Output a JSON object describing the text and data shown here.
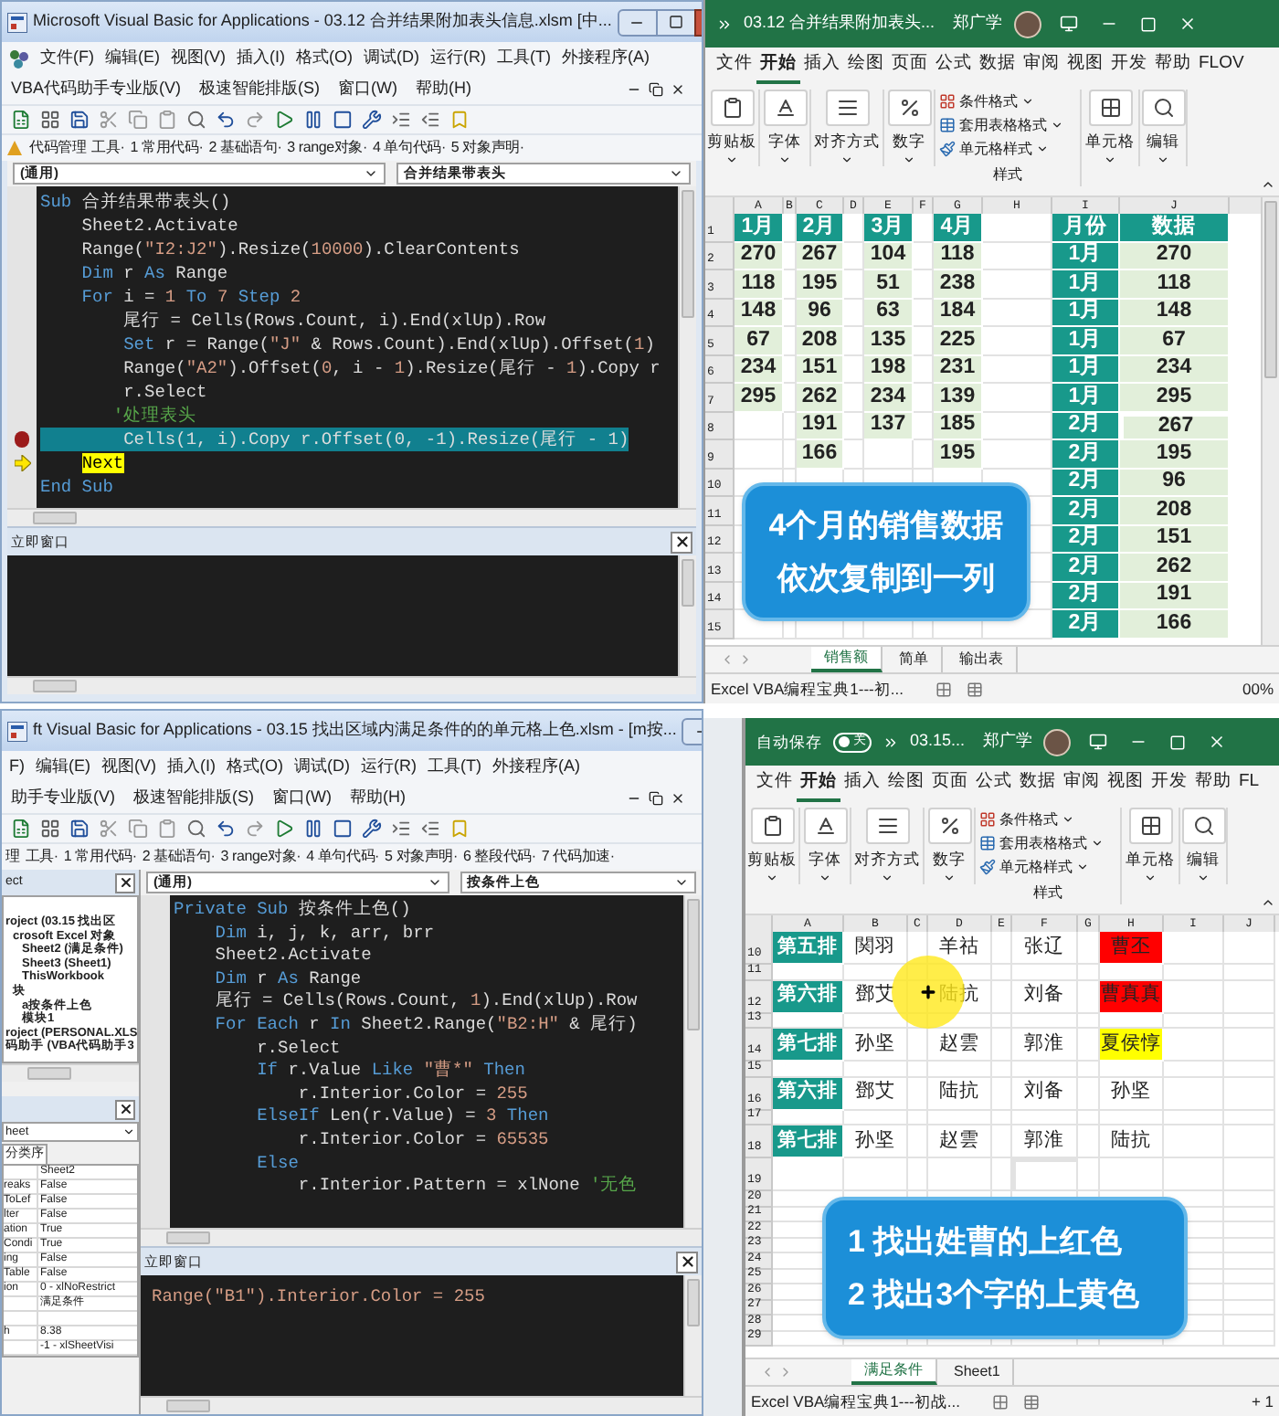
{
  "vba_windows": [
    {
      "title": "Microsoft Visual Basic for Applications - 03.12 合并结果附加表头信息.xlsm [中...",
      "menus": [
        [
          "文件(F)",
          "编辑(E)",
          "视图(V)",
          "插入(I)",
          "格式(O)",
          "调试(D)",
          "运行(R)",
          "工具(T)",
          "外接程序(A)"
        ],
        [
          "VBA代码助手专业版(V)",
          "极速智能排版(S)",
          "窗口(W)",
          "帮助(H)"
        ]
      ],
      "addin_icon": true,
      "addins": [
        "代码管理",
        "工具·",
        "1 常用代码·",
        "2 基础语句·",
        "3 range对象·",
        "4 单句代码·",
        "5 对象声明·"
      ],
      "object_box": "(通用)",
      "proc_box": "合并结果带表头",
      "code": [
        {
          "kind": "plain",
          "tokens": [
            {
              "kind": "kw",
              "text": "Sub "
            },
            {
              "kind": "tx",
              "text": "合并结果带表头()"
            }
          ]
        },
        {
          "kind": "plain",
          "tokens": [
            {
              "kind": "tx",
              "text": "    Sheet2.Activate"
            }
          ]
        },
        {
          "kind": "plain",
          "tokens": [
            {
              "kind": "tx",
              "text": "    Range("
            },
            {
              "kind": "str",
              "text": "\"I2:J2\""
            },
            {
              "kind": "tx",
              "text": ").Resize("
            },
            {
              "kind": "num",
              "text": "10000"
            },
            {
              "kind": "tx",
              "text": ").ClearContents"
            }
          ]
        },
        {
          "kind": "plain",
          "tokens": [
            {
              "kind": "kw",
              "text": "    Dim "
            },
            {
              "kind": "tx",
              "text": "r "
            },
            {
              "kind": "kw",
              "text": "As "
            },
            {
              "kind": "tx",
              "text": "Range"
            }
          ]
        },
        {
          "kind": "plain",
          "tokens": [
            {
              "kind": "kw",
              "text": "    For "
            },
            {
              "kind": "tx",
              "text": "i = "
            },
            {
              "kind": "num",
              "text": "1"
            },
            {
              "kind": "kw",
              "text": " To "
            },
            {
              "kind": "num",
              "text": "7"
            },
            {
              "kind": "kw",
              "text": " Step "
            },
            {
              "kind": "num",
              "text": "2"
            }
          ]
        },
        {
          "kind": "plain",
          "tokens": [
            {
              "kind": "tx",
              "text": "        尾行 = Cells(Rows.Count, i).End(xlUp).Row"
            }
          ]
        },
        {
          "kind": "plain",
          "tokens": [
            {
              "kind": "kw",
              "text": "        Set "
            },
            {
              "kind": "tx",
              "text": "r = Range("
            },
            {
              "kind": "str",
              "text": "\"J\""
            },
            {
              "kind": "tx",
              "text": " & Rows.Count).End(xlUp).Offset("
            },
            {
              "kind": "num",
              "text": "1"
            },
            {
              "kind": "tx",
              "text": ")"
            }
          ]
        },
        {
          "kind": "plain",
          "tokens": [
            {
              "kind": "tx",
              "text": "        Range("
            },
            {
              "kind": "str",
              "text": "\"A2\""
            },
            {
              "kind": "tx",
              "text": ").Offset("
            },
            {
              "kind": "num",
              "text": "0"
            },
            {
              "kind": "tx",
              "text": ", i - "
            },
            {
              "kind": "num",
              "text": "1"
            },
            {
              "kind": "tx",
              "text": ").Resize(尾行 - "
            },
            {
              "kind": "num",
              "text": "1"
            },
            {
              "kind": "tx",
              "text": ").Copy r"
            }
          ]
        },
        {
          "kind": "plain",
          "tokens": [
            {
              "kind": "tx",
              "text": "        r.Select"
            }
          ]
        },
        {
          "kind": "plain",
          "tokens": [
            {
              "kind": "cmt",
              "text": "       '处理表头"
            }
          ]
        },
        {
          "kind": "breakpoint",
          "tokens": [
            {
              "kind": "tx",
              "text": "        Cells(1, i).Copy r.Offset(0, -1).Resize(尾行 - 1)"
            }
          ]
        },
        {
          "kind": "current",
          "tokens": [
            {
              "kind": "exec",
              "text": "    Next"
            }
          ]
        },
        {
          "kind": "plain",
          "tokens": [
            {
              "kind": "kw",
              "text": "End Sub"
            }
          ]
        }
      ],
      "immediate": {
        "title": "立即窗口"
      }
    },
    {
      "title": "ft Visual Basic for Applications - 03.15 找出区域内满足条件的的单元格上色.xlsm - [m按...",
      "menus": [
        [
          "F)",
          "编辑(E)",
          "视图(V)",
          "插入(I)",
          "格式(O)",
          "调试(D)",
          "运行(R)",
          "工具(T)",
          "外接程序(A)"
        ],
        [
          "助手专业版(V)",
          "极速智能排版(S)",
          "窗口(W)",
          "帮助(H)"
        ]
      ],
      "addin_icon": false,
      "addins": [
        "理",
        "工具·",
        "1 常用代码·",
        "2 基础语句·",
        "3 range对象·",
        "4 单句代码·",
        "5 对象声明·",
        "6 整段代码·",
        "7 代码加速·"
      ],
      "object_box": "(通用)",
      "proc_box": "按条件上色",
      "project": {
        "title": "ect",
        "items": [
          {
            "label": "roject (03.15 找出区",
            "children": [
              {
                "label": "crosoft Excel 对象",
                "children": [
                  {
                    "label": "Sheet2 (满足条件)"
                  },
                  {
                    "label": "Sheet3 (Sheet1)"
                  },
                  {
                    "label": "ThisWorkbook"
                  }
                ]
              },
              {
                "label": "块",
                "children": [
                  {
                    "label": "a按条件上色"
                  },
                  {
                    "label": "模块1"
                  }
                ]
              }
            ]
          },
          {
            "label": "roject (PERSONAL.XLS"
          },
          {
            "label": "码助手 (VBA代码助手3"
          }
        ]
      },
      "properties": {
        "object": "heet",
        "tab": "分类序",
        "rows": [
          {
            "value": "Sheet2"
          },
          {
            "name": "reaks",
            "value": "False"
          },
          {
            "name": "ToLef",
            "value": "False"
          },
          {
            "name": "lter",
            "value": "False"
          },
          {
            "name": "ation",
            "value": "True"
          },
          {
            "name": "Condi",
            "value": "True"
          },
          {
            "name": "ing",
            "value": "False"
          },
          {
            "name": "Table",
            "value": "False"
          },
          {
            "name": "ion",
            "value": "0 - xlNoRestrict"
          },
          {
            "value": "满足条件"
          },
          {},
          {
            "name": "h",
            "value": "8.38"
          },
          {
            "value": "-1 - xlSheetVisi"
          }
        ]
      },
      "code": [
        {
          "kind": "plain",
          "tokens": [
            {
              "kind": "kw",
              "text": "Private Sub "
            },
            {
              "kind": "tx",
              "text": "按条件上色()"
            }
          ]
        },
        {
          "kind": "plain",
          "tokens": [
            {
              "kind": "kw",
              "text": "    Dim "
            },
            {
              "kind": "tx",
              "text": "i, j, k, arr, brr"
            }
          ]
        },
        {
          "kind": "plain",
          "tokens": [
            {
              "kind": "tx",
              "text": "    Sheet2.Activate"
            }
          ]
        },
        {
          "kind": "plain",
          "tokens": [
            {
              "kind": "kw",
              "text": "    Dim "
            },
            {
              "kind": "tx",
              "text": "r "
            },
            {
              "kind": "kw",
              "text": "As "
            },
            {
              "kind": "tx",
              "text": "Range"
            }
          ]
        },
        {
          "kind": "plain",
          "tokens": [
            {
              "kind": "tx",
              "text": "    尾行 = Cells(Rows.Count, "
            },
            {
              "kind": "num",
              "text": "1"
            },
            {
              "kind": "tx",
              "text": ").End(xlUp).Row"
            }
          ]
        },
        {
          "kind": "plain",
          "tokens": [
            {
              "kind": "kw",
              "text": "    For Each "
            },
            {
              "kind": "tx",
              "text": "r "
            },
            {
              "kind": "kw",
              "text": "In "
            },
            {
              "kind": "tx",
              "text": "Sheet2.Range("
            },
            {
              "kind": "str",
              "text": "\"B2:H\""
            },
            {
              "kind": "tx",
              "text": " & 尾行)"
            }
          ]
        },
        {
          "kind": "plain",
          "tokens": [
            {
              "kind": "tx",
              "text": "        r.Select"
            }
          ]
        },
        {
          "kind": "plain",
          "tokens": [
            {
              "kind": "kw",
              "text": "        If "
            },
            {
              "kind": "tx",
              "text": "r.Value "
            },
            {
              "kind": "kw",
              "text": "Like "
            },
            {
              "kind": "str",
              "text": "\"曹*\""
            },
            {
              "kind": "kw",
              "text": " Then"
            }
          ]
        },
        {
          "kind": "plain",
          "tokens": [
            {
              "kind": "tx",
              "text": "            r.Interior.Color = "
            },
            {
              "kind": "num",
              "text": "255"
            }
          ]
        },
        {
          "kind": "plain",
          "tokens": [
            {
              "kind": "kw",
              "text": "        ElseIf "
            },
            {
              "kind": "tx",
              "text": "Len(r.Value) = "
            },
            {
              "kind": "num",
              "text": "3"
            },
            {
              "kind": "kw",
              "text": " Then"
            }
          ]
        },
        {
          "kind": "plain",
          "tokens": [
            {
              "kind": "tx",
              "text": "            r.Interior.Color = "
            },
            {
              "kind": "num",
              "text": "65535"
            }
          ]
        },
        {
          "kind": "plain",
          "tokens": [
            {
              "kind": "kw",
              "text": "        Else"
            }
          ]
        },
        {
          "kind": "plain",
          "tokens": [
            {
              "kind": "tx",
              "text": "            r.Interior.Pattern = xlNone "
            },
            {
              "kind": "cmt",
              "text": "'无色"
            }
          ]
        }
      ],
      "immediate": {
        "title": "立即窗口",
        "lines": [
          {
            "tokens": [
              {
                "kind": "str",
                "text": "Range(\"B1\").Interior.Color = 255"
              }
            ]
          }
        ]
      }
    }
  ],
  "excel_windows": [
    {
      "title": "03.12 合并结果附加表头...",
      "user": "郑广学",
      "tabs": [
        {
          "label": "文件",
          "selected": false
        },
        {
          "label": "开始",
          "selected": true
        },
        {
          "label": "插入",
          "selected": false
        },
        {
          "label": "绘图",
          "selected": false
        },
        {
          "label": "页面",
          "selected": false
        },
        {
          "label": "公式",
          "selected": false
        },
        {
          "label": "数据",
          "selected": false
        },
        {
          "label": "审阅",
          "selected": false
        },
        {
          "label": "视图",
          "selected": false
        },
        {
          "label": "开发",
          "selected": false
        },
        {
          "label": "帮助",
          "selected": false
        },
        {
          "label": "FLOV",
          "selected": false
        }
      ],
      "groups": [
        {
          "kind": "clipboard",
          "label": "剪贴板"
        },
        {
          "kind": "font",
          "label": "字体"
        },
        {
          "kind": "align",
          "label": "对齐方式"
        },
        {
          "kind": "number",
          "label": "数字"
        },
        {
          "kind": "styles",
          "label": "样式",
          "items": [
            "条件格式",
            "套用表格格式",
            "单元格样式"
          ]
        },
        {
          "kind": "cells",
          "label": "单元格"
        },
        {
          "kind": "edit",
          "label": "编辑"
        }
      ],
      "sheet": {
        "columns": [
          {
            "name": "A",
            "kind": "band"
          },
          {
            "name": "B",
            "kind": "plain"
          },
          {
            "name": "C",
            "kind": "band"
          },
          {
            "name": "D",
            "kind": "plain"
          },
          {
            "name": "E",
            "kind": "band"
          },
          {
            "name": "F",
            "kind": "plain"
          },
          {
            "name": "G",
            "kind": "band"
          },
          {
            "name": "H",
            "kind": "plain"
          },
          {
            "name": "I",
            "kind": "label"
          },
          {
            "name": "J",
            "kind": "band"
          }
        ],
        "rows": [
          {
            "n": "1",
            "header": true,
            "cells": [
              "1月",
              null,
              "2月",
              null,
              "3月",
              null,
              "4月",
              null,
              "月份",
              "数据"
            ]
          },
          {
            "n": "2",
            "header": false,
            "cells": [
              "270",
              null,
              "267",
              null,
              "104",
              null,
              "118",
              null,
              "1月",
              "270"
            ]
          },
          {
            "n": "3",
            "header": false,
            "cells": [
              "118",
              null,
              "195",
              null,
              "51",
              null,
              "238",
              null,
              "1月",
              "118"
            ]
          },
          {
            "n": "4",
            "header": false,
            "cells": [
              "148",
              null,
              "96",
              null,
              "63",
              null,
              "184",
              null,
              "1月",
              "148"
            ]
          },
          {
            "n": "5",
            "header": false,
            "cells": [
              "67",
              null,
              "208",
              null,
              "135",
              null,
              "225",
              null,
              "1月",
              "67"
            ]
          },
          {
            "n": "6",
            "header": false,
            "cells": [
              "234",
              null,
              "151",
              null,
              "198",
              null,
              "231",
              null,
              "1月",
              "234"
            ]
          },
          {
            "n": "7",
            "header": false,
            "cells": [
              "295",
              null,
              "262",
              null,
              "234",
              null,
              "139",
              null,
              "1月",
              "295"
            ]
          },
          {
            "n": "8",
            "header": false,
            "cells": [
              null,
              null,
              "191",
              null,
              "137",
              null,
              "185",
              null,
              "2月",
              {
                "v": "267",
                "selected": true
              }
            ]
          },
          {
            "n": "9",
            "header": false,
            "cells": [
              null,
              null,
              "166",
              null,
              null,
              null,
              "195",
              null,
              "2月",
              "195"
            ]
          },
          {
            "n": "10",
            "header": false,
            "cells": [
              null,
              null,
              null,
              null,
              null,
              null,
              null,
              null,
              "2月",
              "96"
            ]
          },
          {
            "n": "11",
            "header": false,
            "cells": [
              null,
              null,
              null,
              null,
              null,
              null,
              null,
              null,
              "2月",
              "208"
            ]
          },
          {
            "n": "12",
            "header": false,
            "cells": [
              null,
              null,
              null,
              null,
              null,
              null,
              null,
              null,
              "2月",
              "151"
            ]
          },
          {
            "n": "13",
            "header": false,
            "cells": [
              null,
              null,
              null,
              null,
              null,
              null,
              null,
              null,
              "2月",
              "262"
            ]
          },
          {
            "n": "14",
            "header": false,
            "cells": [
              null,
              null,
              null,
              null,
              null,
              null,
              null,
              null,
              "2月",
              "191"
            ]
          },
          {
            "n": "15",
            "header": false,
            "cells": [
              null,
              null,
              null,
              null,
              null,
              null,
              null,
              null,
              "2月",
              "166"
            ]
          }
        ]
      },
      "sheet_tabs": [
        {
          "label": "销售额",
          "selected": true
        },
        {
          "label": "简单",
          "selected": false
        },
        {
          "label": "输出表",
          "selected": false
        }
      ],
      "status": "Excel VBA编程宝典1---初...",
      "zoom": "00%",
      "callout": [
        "4个月的销售数据",
        "依次复制到一列"
      ],
      "cursor_highlight": false
    },
    {
      "autosave": {
        "label": "自动保存",
        "on": false,
        "text": "关"
      },
      "title": "03.15...",
      "user": "郑广学",
      "tabs": [
        {
          "label": "文件",
          "selected": false
        },
        {
          "label": "开始",
          "selected": true
        },
        {
          "label": "插入",
          "selected": false
        },
        {
          "label": "绘图",
          "selected": false
        },
        {
          "label": "页面",
          "selected": false
        },
        {
          "label": "公式",
          "selected": false
        },
        {
          "label": "数据",
          "selected": false
        },
        {
          "label": "审阅",
          "selected": false
        },
        {
          "label": "视图",
          "selected": false
        },
        {
          "label": "开发",
          "selected": false
        },
        {
          "label": "帮助",
          "selected": false
        },
        {
          "label": "FL",
          "selected": false
        }
      ],
      "groups": [
        {
          "kind": "clipboard",
          "label": "剪贴板"
        },
        {
          "kind": "font",
          "label": "字体"
        },
        {
          "kind": "align",
          "label": "对齐方式"
        },
        {
          "kind": "number",
          "label": "数字"
        },
        {
          "kind": "styles",
          "label": "样式",
          "items": [
            "条件格式",
            "套用表格格式",
            "单元格样式"
          ]
        },
        {
          "kind": "cells",
          "label": "单元格"
        },
        {
          "kind": "edit",
          "label": "编辑"
        }
      ],
      "sheet": {
        "columns": [
          {
            "name": "A",
            "kind": "label"
          },
          {
            "name": "B",
            "kind": "plain"
          },
          {
            "name": "C",
            "kind": "plain"
          },
          {
            "name": "D",
            "kind": "plain"
          },
          {
            "name": "E",
            "kind": "plain"
          },
          {
            "name": "F",
            "kind": "plain"
          },
          {
            "name": "G",
            "kind": "plain"
          },
          {
            "name": "H",
            "kind": "plain"
          },
          {
            "name": "I",
            "kind": "plain"
          },
          {
            "name": "J",
            "kind": "plain"
          }
        ],
        "rows": [
          {
            "n": "10",
            "cells": [
              "第五排",
              "関羽",
              null,
              "羊祜",
              null,
              "张辽",
              null,
              {
                "v": "曹丕",
                "color": "#ff0000"
              }
            ]
          },
          {
            "n": "11"
          },
          {
            "n": "12",
            "cells": [
              "第六排",
              "鄧艾",
              null,
              "陆抗",
              null,
              "刘备",
              null,
              {
                "v": "曹真真",
                "color": "#ff0000"
              }
            ]
          },
          {
            "n": "13"
          },
          {
            "n": "14",
            "cells": [
              "第七排",
              "孙坚",
              null,
              "赵雲",
              null,
              "郭淮",
              null,
              {
                "v": "夏侯惇",
                "color": "#ffff00"
              }
            ]
          },
          {
            "n": "15"
          },
          {
            "n": "16",
            "cells": [
              "第六排",
              "鄧艾",
              null,
              "陆抗",
              null,
              "刘备",
              null,
              "孙坚"
            ]
          },
          {
            "n": "17"
          },
          {
            "n": "18",
            "cells": [
              "第七排",
              "孙坚",
              null,
              "赵雲",
              null,
              "郭淮",
              null,
              "陆抗"
            ]
          },
          {
            "n": "19",
            "cells": [
              null,
              null,
              null,
              null,
              null,
              {
                "selected": true
              }
            ]
          },
          {
            "n": "20"
          },
          {
            "n": "21"
          },
          {
            "n": "22"
          },
          {
            "n": "23"
          },
          {
            "n": "24"
          },
          {
            "n": "25"
          },
          {
            "n": "26"
          },
          {
            "n": "27"
          },
          {
            "n": "28"
          },
          {
            "n": "29"
          }
        ]
      },
      "sheet_tabs": [
        {
          "label": "满足条件",
          "selected": true
        },
        {
          "label": "Sheet1",
          "selected": false
        }
      ],
      "status": "Excel VBA编程宝典1---初战...",
      "zoom": "+ 1",
      "callout": [
        "1 找出姓曹的上红色",
        "2 找出3个字的上黄色"
      ],
      "cursor_highlight": true
    }
  ]
}
